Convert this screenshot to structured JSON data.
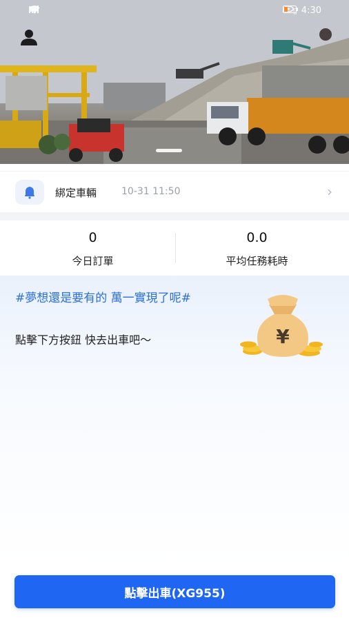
{
  "status_bar": {
    "left_icons": [
      "hd-icon",
      "signal-icon",
      "wifi-icon"
    ],
    "right_icons": [
      "eye-icon",
      "bluetooth-icon",
      "vibrate-icon",
      "battery-icon"
    ],
    "time": "4:30"
  },
  "hero": {
    "image": "construction-site-banner",
    "avatar_icon": "user-icon"
  },
  "notice": {
    "icon": "bell-icon",
    "title": "綁定車輛",
    "time": "10-31 11:50",
    "arrow_icon": "chevron-right-icon"
  },
  "stats": {
    "orders_today": {
      "value": "0",
      "label": "今日訂單"
    },
    "avg_task_time": {
      "value": "0.0",
      "label": "平均任務耗時"
    }
  },
  "message": {
    "headline": "#夢想還是要有的 萬一實現了呢#",
    "sub": "點擊下方按鈕 快去出車吧～",
    "illustration": "money-bag-icon"
  },
  "cta": {
    "label": "點擊出車(XG955)"
  },
  "colors": {
    "primary": "#1f67f2",
    "headline": "#2a6fdb",
    "divider": "#f3f4f6"
  }
}
